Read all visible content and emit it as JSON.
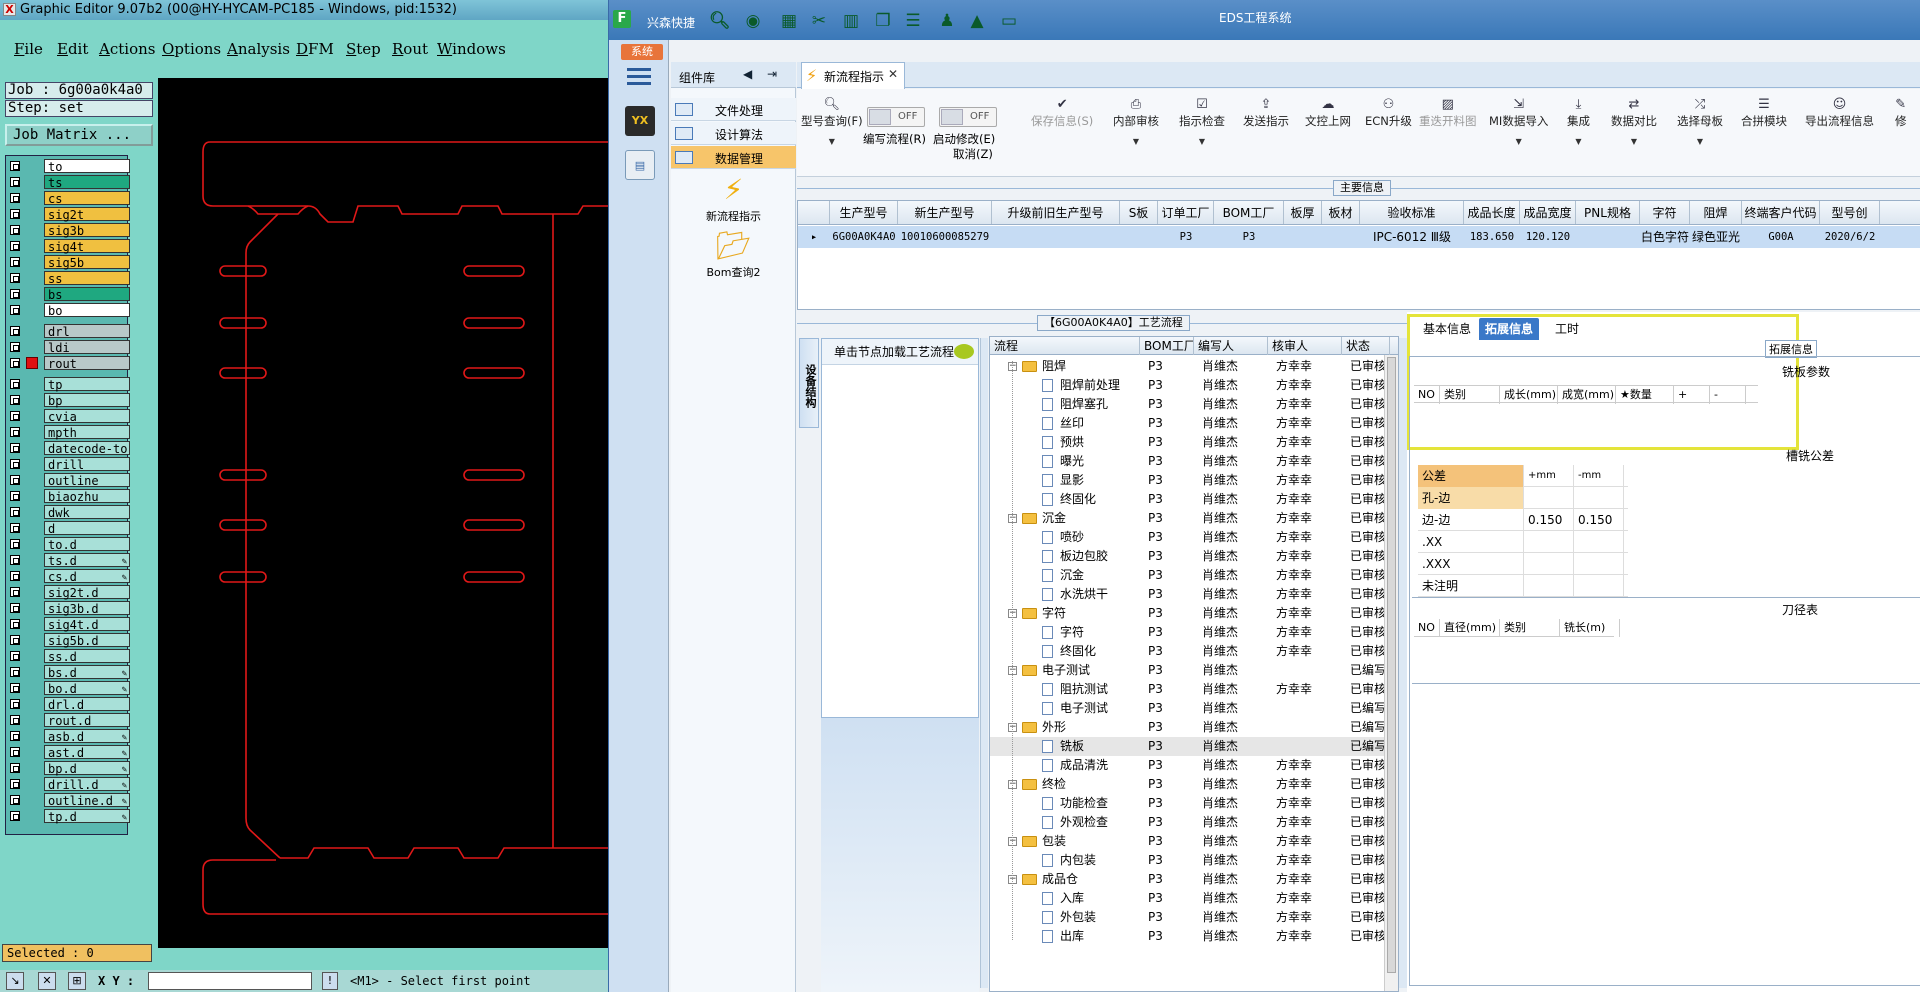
{
  "graphic_editor": {
    "title": "Graphic Editor 9.07b2 (00@HY-HYCAM-PC185 - Windows, pid:1532)",
    "menu": [
      "File",
      "Edit",
      "Actions",
      "Options",
      "Analysis",
      "DFM",
      "Step",
      "Rout",
      "Windows"
    ],
    "job": "Job : 6g00a0k4a0",
    "step": "Step: set",
    "job_matrix": "Job Matrix ...",
    "layers": [
      {
        "name": "to",
        "color": "#ffffff"
      },
      {
        "name": "ts",
        "color": "#1fa880"
      },
      {
        "name": "cs",
        "color": "#f0c040"
      },
      {
        "name": "sig2t",
        "color": "#f0c040"
      },
      {
        "name": "sig3b",
        "color": "#f0c040"
      },
      {
        "name": "sig4t",
        "color": "#f0c040"
      },
      {
        "name": "sig5b",
        "color": "#f0c040"
      },
      {
        "name": "ss",
        "color": "#f0c040"
      },
      {
        "name": "bs",
        "color": "#1fa880"
      },
      {
        "name": "bo",
        "color": "#ffffff"
      },
      {
        "name": "drl",
        "color": "#b8c8c8"
      },
      {
        "name": "ldi",
        "color": "#b8c8c8"
      },
      {
        "name": "rout",
        "color": "#b8c8c8"
      },
      {
        "name": "tp",
        "color": "#a8e0d8"
      },
      {
        "name": "bp",
        "color": "#a8e0d8"
      },
      {
        "name": "cvia",
        "color": "#a8e0d8"
      },
      {
        "name": "mpth",
        "color": "#a8e0d8"
      },
      {
        "name": "datecode-to",
        "color": "#a8e0d8"
      },
      {
        "name": "drill",
        "color": "#a8e0d8"
      },
      {
        "name": "outline",
        "color": "#a8e0d8"
      },
      {
        "name": "biaozhu",
        "color": "#a8e0d8"
      },
      {
        "name": "dwk",
        "color": "#a8e0d8"
      },
      {
        "name": "d",
        "color": "#a8e0d8"
      },
      {
        "name": "to.d",
        "color": "#a8e0d8"
      },
      {
        "name": "ts.d",
        "color": "#a8e0d8"
      },
      {
        "name": "cs.d",
        "color": "#a8e0d8"
      },
      {
        "name": "sig2t.d",
        "color": "#a8e0d8"
      },
      {
        "name": "sig3b.d",
        "color": "#a8e0d8"
      },
      {
        "name": "sig4t.d",
        "color": "#a8e0d8"
      },
      {
        "name": "sig5b.d",
        "color": "#a8e0d8"
      },
      {
        "name": "ss.d",
        "color": "#a8e0d8"
      },
      {
        "name": "bs.d",
        "color": "#a8e0d8"
      },
      {
        "name": "bo.d",
        "color": "#a8e0d8"
      },
      {
        "name": "drl.d",
        "color": "#a8e0d8"
      },
      {
        "name": "rout.d",
        "color": "#a8e0d8"
      },
      {
        "name": "asb.d",
        "color": "#a8e0d8"
      },
      {
        "name": "ast.d",
        "color": "#a8e0d8"
      },
      {
        "name": "bp.d",
        "color": "#a8e0d8"
      },
      {
        "name": "drill.d",
        "color": "#a8e0d8"
      },
      {
        "name": "outline.d",
        "color": "#a8e0d8"
      },
      {
        "name": "tp.d",
        "color": "#a8e0d8"
      }
    ],
    "selected": "Selected : 0",
    "xy_label": "X Y :",
    "prompt": "<M1> - Select first point"
  },
  "eds": {
    "title": "EDS工程系统",
    "app_name": "兴森快捷",
    "logo": "F",
    "system_tab": "系统",
    "component_panel": {
      "title": "组件库",
      "items": [
        "文件处理",
        "设计算法",
        "数据管理"
      ],
      "selected": "数据管理",
      "big_items": [
        "新流程指示",
        "Bom查询2"
      ]
    },
    "tab": "新流程指示",
    "toolbar": {
      "type_query": "型号查询(F)",
      "write_flow": "编写流程(R)",
      "start_modify": "启动修改(E)",
      "cancel": "取消(Z)",
      "toggle_off": "OFF",
      "buttons": [
        "保存信息(S)",
        "内部审核",
        "指示检查",
        "发送指示",
        "文控上网",
        "ECN升级",
        "重迭开料图",
        "MI数据导入",
        "集成",
        "数据对比",
        "选择母板",
        "合拼模块",
        "导出流程信息",
        "修"
      ]
    },
    "main_info": {
      "label": "主要信息",
      "columns": [
        "生产型号",
        "新生产型号",
        "升级前旧生产型号",
        "S板",
        "订单工厂",
        "BOM工厂",
        "板厚",
        "板材",
        "验收标准",
        "成品长度",
        "成品宽度",
        "PNL规格",
        "字符",
        "阻焊",
        "终端客户代码",
        "型号创"
      ],
      "row": [
        "6G00A0K4A0",
        "10010600085279",
        "",
        "",
        "P3",
        "P3",
        "",
        "",
        "IPC-6012 Ⅲ级",
        "183.650",
        "120.120",
        "",
        "白色字符",
        "绿色亚光",
        "G00A",
        "2020/6/2"
      ]
    },
    "flow": {
      "label": "【6G00A0K4A0】工艺流程",
      "side_tab": "设备结构",
      "click_hint": "单击节点加载工艺流程",
      "columns": [
        "流程",
        "BOM工厂",
        "编写人",
        "核审人",
        "状态"
      ],
      "rows": [
        {
          "name": "阻焊",
          "level": 0,
          "factory": "P3",
          "writer": "肖维杰",
          "checker": "方幸幸",
          "status": "已审核"
        },
        {
          "name": "阻焊前处理",
          "level": 1,
          "factory": "P3",
          "writer": "肖维杰",
          "checker": "方幸幸",
          "status": "已审核"
        },
        {
          "name": "阻焊塞孔",
          "level": 1,
          "factory": "P3",
          "writer": "肖维杰",
          "checker": "方幸幸",
          "status": "已审核"
        },
        {
          "name": "丝印",
          "level": 1,
          "factory": "P3",
          "writer": "肖维杰",
          "checker": "方幸幸",
          "status": "已审核"
        },
        {
          "name": "预烘",
          "level": 1,
          "factory": "P3",
          "writer": "肖维杰",
          "checker": "方幸幸",
          "status": "已审核"
        },
        {
          "name": "曝光",
          "level": 1,
          "factory": "P3",
          "writer": "肖维杰",
          "checker": "方幸幸",
          "status": "已审核"
        },
        {
          "name": "显影",
          "level": 1,
          "factory": "P3",
          "writer": "肖维杰",
          "checker": "方幸幸",
          "status": "已审核"
        },
        {
          "name": "终固化",
          "level": 1,
          "factory": "P3",
          "writer": "肖维杰",
          "checker": "方幸幸",
          "status": "已审核"
        },
        {
          "name": "沉金",
          "level": 0,
          "factory": "P3",
          "writer": "肖维杰",
          "checker": "方幸幸",
          "status": "已审核"
        },
        {
          "name": "喷砂",
          "level": 1,
          "factory": "P3",
          "writer": "肖维杰",
          "checker": "方幸幸",
          "status": "已审核"
        },
        {
          "name": "板边包胶",
          "level": 1,
          "factory": "P3",
          "writer": "肖维杰",
          "checker": "方幸幸",
          "status": "已审核"
        },
        {
          "name": "沉金",
          "level": 1,
          "factory": "P3",
          "writer": "肖维杰",
          "checker": "方幸幸",
          "status": "已审核"
        },
        {
          "name": "水洗烘干",
          "level": 1,
          "factory": "P3",
          "writer": "肖维杰",
          "checker": "方幸幸",
          "status": "已审核"
        },
        {
          "name": "字符",
          "level": 0,
          "factory": "P3",
          "writer": "肖维杰",
          "checker": "方幸幸",
          "status": "已审核"
        },
        {
          "name": "字符",
          "level": 1,
          "factory": "P3",
          "writer": "肖维杰",
          "checker": "方幸幸",
          "status": "已审核"
        },
        {
          "name": "终固化",
          "level": 1,
          "factory": "P3",
          "writer": "肖维杰",
          "checker": "方幸幸",
          "status": "已审核"
        },
        {
          "name": "电子测试",
          "level": 0,
          "factory": "P3",
          "writer": "肖维杰",
          "checker": "",
          "status": "已编写"
        },
        {
          "name": "阻抗测试",
          "level": 1,
          "factory": "P3",
          "writer": "肖维杰",
          "checker": "方幸幸",
          "status": "已审核"
        },
        {
          "name": "电子测试",
          "level": 1,
          "factory": "P3",
          "writer": "肖维杰",
          "checker": "",
          "status": "已编写"
        },
        {
          "name": "外形",
          "level": 0,
          "factory": "P3",
          "writer": "肖维杰",
          "checker": "",
          "status": "已编写"
        },
        {
          "name": "铣板",
          "level": 1,
          "factory": "P3",
          "writer": "肖维杰",
          "checker": "",
          "status": "已编写",
          "selected": true
        },
        {
          "name": "成品清洗",
          "level": 1,
          "factory": "P3",
          "writer": "肖维杰",
          "checker": "方幸幸",
          "status": "已审核"
        },
        {
          "name": "终检",
          "level": 0,
          "factory": "P3",
          "writer": "肖维杰",
          "checker": "方幸幸",
          "status": "已审核"
        },
        {
          "name": "功能检查",
          "level": 1,
          "factory": "P3",
          "writer": "肖维杰",
          "checker": "方幸幸",
          "status": "已审核"
        },
        {
          "name": "外观检查",
          "level": 1,
          "factory": "P3",
          "writer": "肖维杰",
          "checker": "方幸幸",
          "status": "已审核"
        },
        {
          "name": "包装",
          "level": 0,
          "factory": "P3",
          "writer": "肖维杰",
          "checker": "方幸幸",
          "status": "已审核"
        },
        {
          "name": "内包装",
          "level": 1,
          "factory": "P3",
          "writer": "肖维杰",
          "checker": "方幸幸",
          "status": "已审核"
        },
        {
          "name": "成品仓",
          "level": 0,
          "factory": "P3",
          "writer": "肖维杰",
          "checker": "方幸幸",
          "status": "已审核"
        },
        {
          "name": "入库",
          "level": 1,
          "factory": "P3",
          "writer": "肖维杰",
          "checker": "方幸幸",
          "status": "已审核"
        },
        {
          "name": "外包装",
          "level": 1,
          "factory": "P3",
          "writer": "肖维杰",
          "checker": "方幸幸",
          "status": "已审核"
        },
        {
          "name": "出库",
          "level": 1,
          "factory": "P3",
          "writer": "肖维杰",
          "checker": "方幸幸",
          "status": "已审核"
        }
      ]
    },
    "detail": {
      "tabs": [
        "基本信息",
        "拓展信息",
        "工时"
      ],
      "active_tab": "拓展信息",
      "ext_label": "拓展信息",
      "mill_params": "铣板参数",
      "mill_columns": [
        "NO",
        "类别",
        "成长(mm)",
        "成宽(mm)",
        "★数量",
        "+",
        "-"
      ],
      "slot_tol": "槽铣公差",
      "tol_columns": [
        "公差",
        "+mm",
        "-mm"
      ],
      "tol_rows": [
        [
          "孔-边",
          "",
          ""
        ],
        [
          "边-边",
          "0.150",
          "0.150"
        ],
        [
          ".XX",
          "",
          ""
        ],
        [
          ".XXX",
          "",
          ""
        ],
        [
          "未注明",
          "",
          ""
        ]
      ],
      "knife_table": "刀径表",
      "knife_columns": [
        "NO",
        "直径(mm)",
        "类别",
        "铣长(m)"
      ]
    }
  }
}
